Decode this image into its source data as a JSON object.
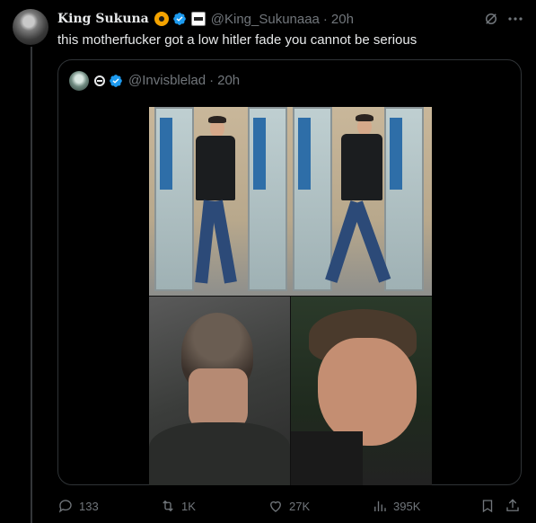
{
  "author": {
    "display_name": "King Sukuna",
    "handle": "@King_Sukunaaa",
    "separator": "·",
    "time": "20h",
    "emoji_icon": "radioactive-icon",
    "badge_icon": "verified-badge-icon",
    "affiliate_icon": "affiliate-badge-icon"
  },
  "tweet": {
    "text": "this motherfucker got a low hitler fade you cannot be serious"
  },
  "quote": {
    "handle": "@Invisblelad",
    "separator": "·",
    "time": "20h",
    "name_icon": "theta-symbol-icon",
    "badge_icon": "verified-badge-icon"
  },
  "actions": {
    "replies": "133",
    "reposts": "1K",
    "likes": "27K",
    "views": "395K"
  },
  "colors": {
    "background": "#000000",
    "text": "#e7e9ea",
    "muted": "#71767b",
    "border": "#2f3336",
    "verified": "#1d9bf0"
  }
}
